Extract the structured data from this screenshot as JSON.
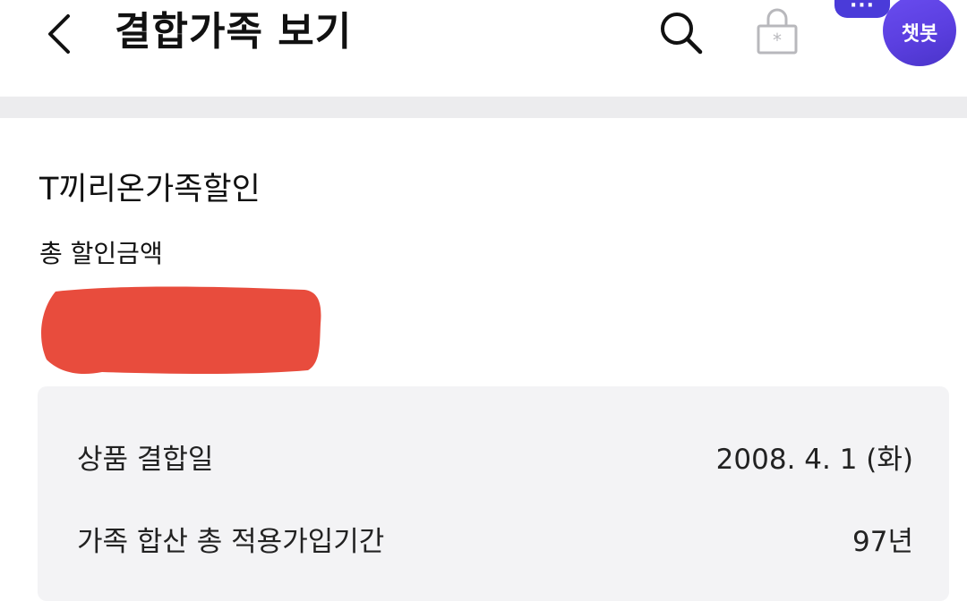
{
  "header": {
    "title": "결합가족 보기",
    "back_icon": "chevron-left-icon",
    "search_icon": "search-icon",
    "lock_icon": "lock-icon",
    "chatbot_dots": "···",
    "chatbot_label": "챗봇"
  },
  "plan": {
    "name": "T끼리온가족할인",
    "total_discount_label": "총 할인금액"
  },
  "details": [
    {
      "label": "상품 결합일",
      "value": "2008. 4. 1 (화)"
    },
    {
      "label": "가족 합산 총 적용가입기간",
      "value": "97년"
    }
  ],
  "colors": {
    "accent": "#5b3fe0",
    "redaction": "#e84c3d",
    "band": "#ececee",
    "card": "#f3f3f5"
  }
}
